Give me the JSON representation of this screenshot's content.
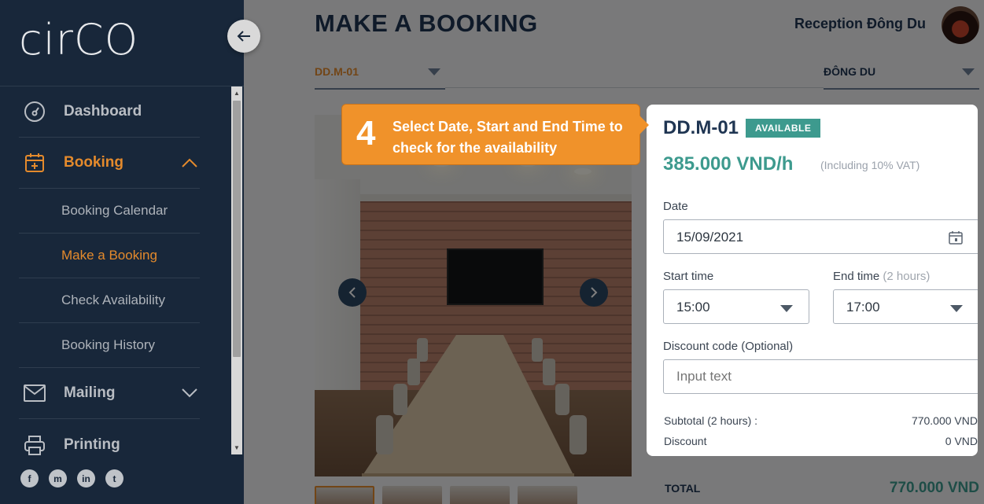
{
  "sidebar": {
    "logo": "cirCO",
    "items": [
      {
        "label": "Dashboard",
        "icon": "dashboard-icon"
      },
      {
        "label": "Booking",
        "icon": "calendar-plus-icon",
        "active": true,
        "expanded": true
      },
      {
        "label": "Mailing",
        "icon": "mail-icon"
      },
      {
        "label": "Printing",
        "icon": "printer-icon"
      }
    ],
    "booking_sub": [
      {
        "label": "Booking Calendar"
      },
      {
        "label": "Make a Booking",
        "active": true
      },
      {
        "label": "Check Availability"
      },
      {
        "label": "Booking History"
      }
    ],
    "social": [
      "f",
      "m",
      "in",
      "t"
    ]
  },
  "header": {
    "title": "MAKE A BOOKING",
    "user_name": "Reception Đông Du"
  },
  "filters": {
    "room": "DD.M-01",
    "location": "ĐÔNG DU"
  },
  "tooltip": {
    "step": "4",
    "text": "Select Date, Start and End Time to check for the availability"
  },
  "card": {
    "room_code": "DD.M-01",
    "status": "AVAILABLE",
    "price": "385.000 VND/h",
    "vat_note": "(Including 10% VAT)",
    "date_label": "Date",
    "date_value": "15/09/2021",
    "start_label": "Start time",
    "start_value": "15:00",
    "end_label": "End time",
    "end_note": "(2 hours)",
    "end_value": "17:00",
    "discount_label": "Discount code (Optional)",
    "discount_placeholder": "Input text",
    "subtotal_label": "Subtotal (2 hours) :",
    "subtotal_value": "770.000 VND",
    "discount_row_label": "Discount",
    "discount_row_value": "0 VND"
  },
  "total": {
    "label": "TOTAL",
    "value": "770.000 VND"
  },
  "colors": {
    "sidebar_bg": "#18273a",
    "accent_orange": "#e48a2c",
    "accent_teal": "#3d9a8e",
    "title_navy": "#1f3552"
  }
}
